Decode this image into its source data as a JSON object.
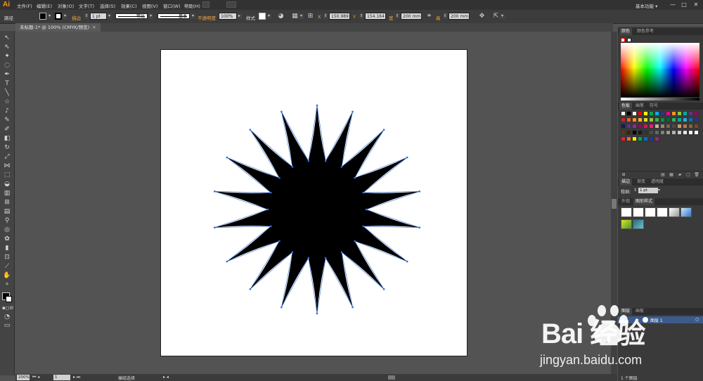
{
  "app": {
    "logo": "Ai"
  },
  "menu": [
    "文件(F)",
    "编辑(E)",
    "对象(O)",
    "文字(T)",
    "选择(S)",
    "效果(C)",
    "视图(V)",
    "窗口(W)",
    "帮助(H)"
  ],
  "workspace": {
    "label": "基本功能 ▾",
    "minimize": "—",
    "maximize": "□",
    "close": "✕"
  },
  "control": {
    "selection_label": "路径",
    "stroke_label": "描边",
    "stroke_weight": "1 pt",
    "profile": "等比",
    "brush": "基本",
    "opacity_label": "不透明度",
    "opacity": "100%",
    "style_label": "样式",
    "x_label": "X",
    "x_value": "150.989",
    "y_label": "Y",
    "y_value": "154.164",
    "w_label": "宽",
    "w_value": "200 mm",
    "h_label": "高",
    "h_value": "200 mm"
  },
  "document": {
    "tab_title": "未标题-1* @ 100% (CMYK/预览)",
    "close": "✕"
  },
  "artwork": {
    "points": 18,
    "fill": "#000000",
    "path_color": "#2f6ed8"
  },
  "status": {
    "zoom": "200%",
    "page": "1",
    "tool": "编组选择"
  },
  "panels": {
    "color": {
      "tabs": [
        "颜色",
        "颜色参考"
      ]
    },
    "swatches": {
      "tabs": [
        "色板",
        "画笔",
        "符号"
      ]
    },
    "stroke": {
      "tabs": [
        "描边",
        "渐变",
        "透明度"
      ],
      "weight_label": "粗细:",
      "weight": "1 pt"
    },
    "appearance": {
      "tabs": [
        "外观",
        "图形样式"
      ]
    },
    "layers": {
      "tabs": [
        "图层",
        "画板"
      ],
      "layer_name": "图层 1",
      "footer": "1 个图层"
    }
  },
  "swatch_colors": [
    [
      "#ffffff",
      "#000000",
      "#ffffff",
      "#ff0000",
      "#ffff00",
      "#00a651",
      "#00aeef",
      "#2e3192",
      "#ec008c",
      "#f7941d",
      "#8dc63f",
      "#00a99d",
      "#662d91",
      "#9e005d"
    ],
    [
      "#c1272d",
      "#f15a24",
      "#f7931e",
      "#fbb03b",
      "#d9e021",
      "#8cc63f",
      "#39b54a",
      "#009245",
      "#006837",
      "#22b573",
      "#00a99d",
      "#29abe2",
      "#0071bc",
      "#2e3192"
    ],
    [
      "#1b1464",
      "#662d91",
      "#93278f",
      "#9e005d",
      "#d4145a",
      "#ed1e79",
      "#c7b299",
      "#998675",
      "#736357",
      "#534741",
      "#c69c6d",
      "#a67c52",
      "#8c6239",
      "#754c24"
    ],
    [
      "#603813",
      "#42210b",
      "#000000",
      "#1a1a1a",
      "#333333",
      "#4d4d4d",
      "#666666",
      "#808080",
      "#999999",
      "#b3b3b3",
      "#cccccc",
      "#e6e6e6",
      "#f2f2f2",
      "#ffffff"
    ],
    [
      "#ed1c24",
      "#f26522",
      "#fff200",
      "#00a651",
      "#0072bc",
      "#2e3192",
      "#92278f"
    ]
  ],
  "watermark": {
    "main": "Bai  经验",
    "url": "jingyan.baidu.com",
    "paw_color": "#ffffff"
  }
}
